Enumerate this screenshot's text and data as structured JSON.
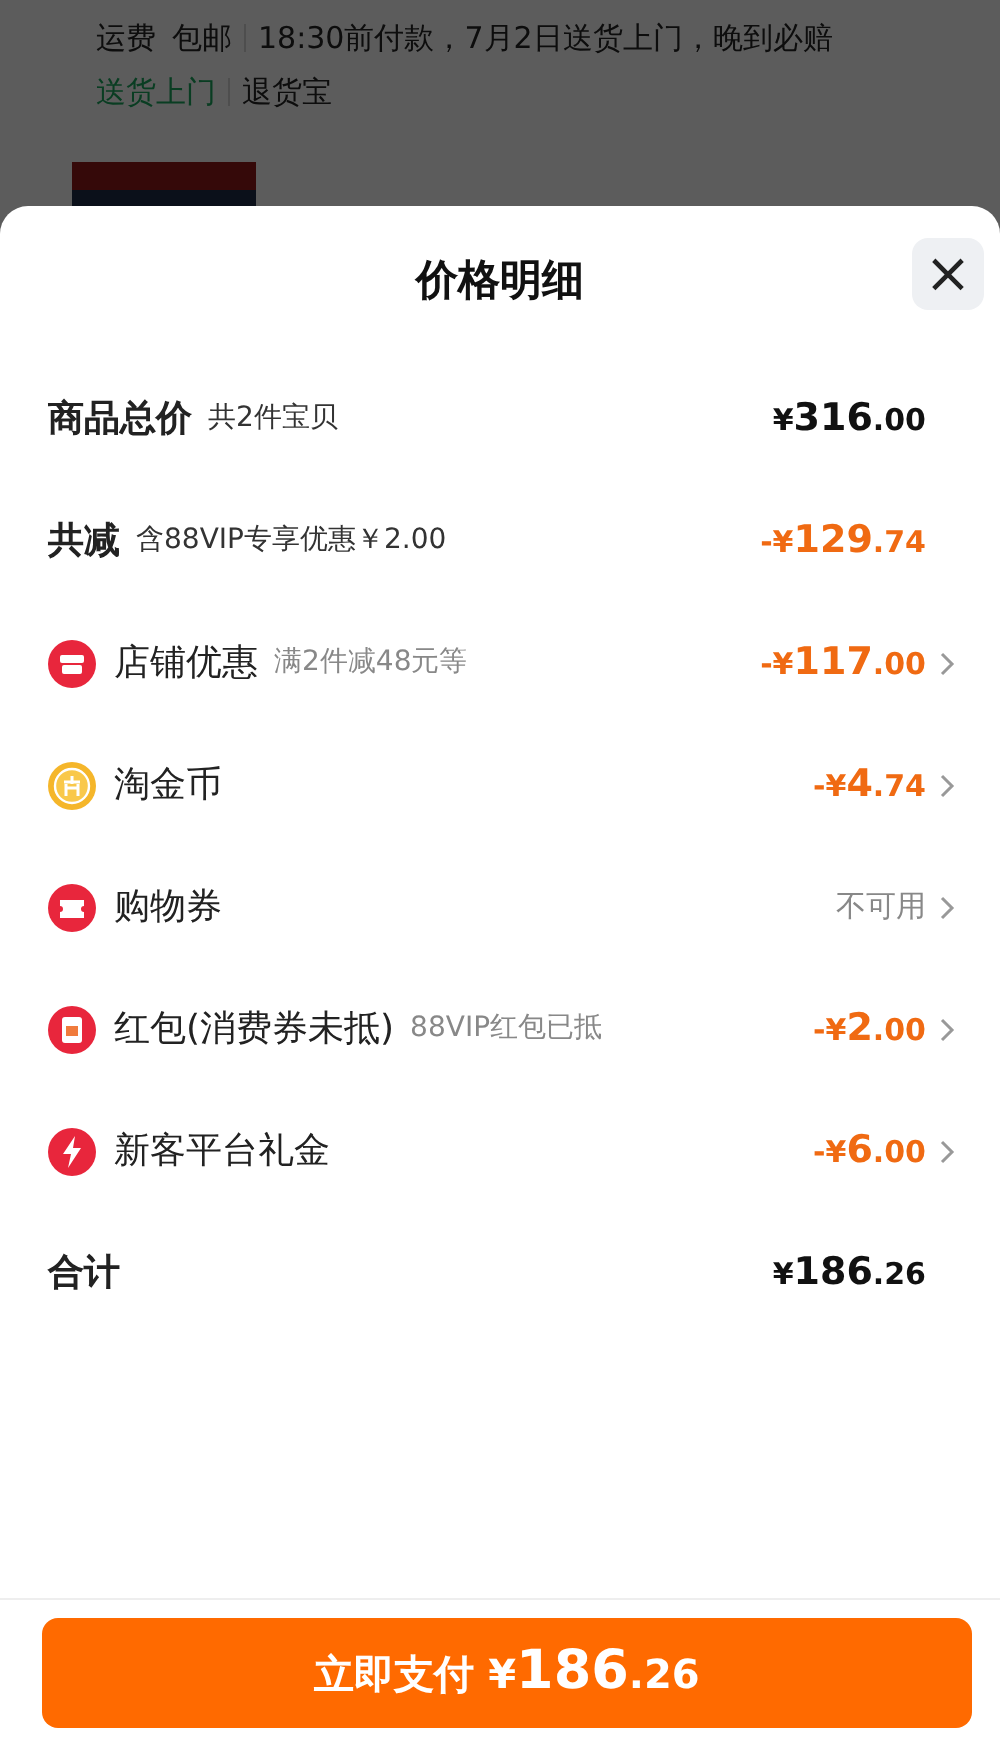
{
  "background_page": {
    "shipping_label": "运费",
    "shipping_value": "包邮",
    "delivery_note": "18:30前付款，7月2日送货上门，晚到必赔",
    "tags": [
      {
        "label": "送货上门",
        "kind": "green"
      },
      {
        "label": "退货宝",
        "kind": "plain"
      }
    ]
  },
  "sheet": {
    "title": "价格明细",
    "close": "×",
    "rows": [
      {
        "kind": "total",
        "label": "商品总价",
        "note": "共2件宝贝",
        "amount": "¥316.00",
        "available": true,
        "has_arrow": false
      },
      {
        "kind": "reduction",
        "label": "共减",
        "note": "含88VIP专享优惠￥2.00",
        "amount": "-¥129.74",
        "available": true,
        "has_arrow": false
      },
      {
        "kind": "shop",
        "label": "店铺优惠",
        "note": "满2件减48元等",
        "amount": "-¥117.00",
        "available": true,
        "has_arrow": true
      },
      {
        "kind": "coin",
        "label": "淘金币",
        "amount": "-¥4.74",
        "available": true,
        "has_arrow": true
      },
      {
        "kind": "ticket",
        "label": "购物券",
        "amount": "不可用",
        "available": false,
        "has_arrow": true
      },
      {
        "kind": "packet",
        "label": "红包(消费券未抵)",
        "note": "88VIP红包已抵",
        "amount": "-¥2.00",
        "available": true,
        "has_arrow": true
      },
      {
        "kind": "bolt",
        "label": "新客平台礼金",
        "amount": "-¥6.00",
        "available": true,
        "has_arrow": true
      },
      {
        "kind": "total",
        "label": "合计",
        "amount": "¥186.26",
        "available": true,
        "has_arrow": false
      }
    ],
    "pay_button": {
      "label": "立即支付",
      "amount": "¥186.26"
    }
  }
}
